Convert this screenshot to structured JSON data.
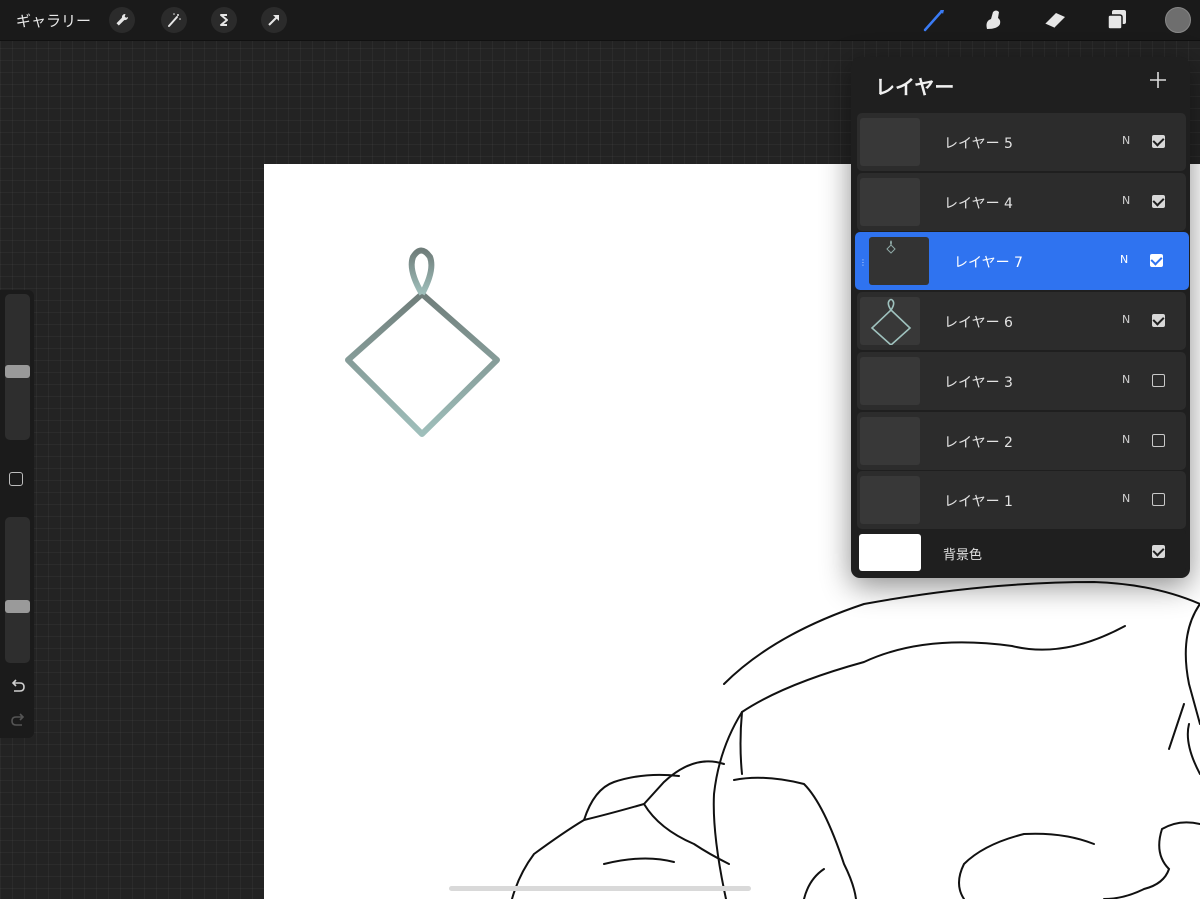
{
  "topbar": {
    "gallery_label": "ギャラリー",
    "left_tools": [
      "wrench-icon",
      "magic-wand-icon",
      "selection-icon",
      "transform-arrow-icon"
    ],
    "right_tools": [
      "brush-icon",
      "smudge-icon",
      "eraser-icon",
      "layers-icon"
    ],
    "active_tool": "brush",
    "accent_color": "#2f73f0",
    "current_color": "#6e6e6e"
  },
  "sidebar": {
    "brush_size_level": 0.45,
    "opacity_level": 0.6
  },
  "layers_panel": {
    "title": "レイヤー",
    "add_icon": "plus-icon",
    "layers": [
      {
        "name": "レイヤー 5",
        "blend": "N",
        "visible": true,
        "active": false
      },
      {
        "name": "レイヤー 4",
        "blend": "N",
        "visible": true,
        "active": false
      },
      {
        "name": "レイヤー 7",
        "blend": "N",
        "visible": true,
        "active": true
      },
      {
        "name": "レイヤー 6",
        "blend": "N",
        "visible": true,
        "active": false
      },
      {
        "name": "レイヤー 3",
        "blend": "N",
        "visible": false,
        "active": false
      },
      {
        "name": "レイヤー 2",
        "blend": "N",
        "visible": false,
        "active": false
      },
      {
        "name": "レイヤー 1",
        "blend": "N",
        "visible": false,
        "active": false
      }
    ],
    "background": {
      "name": "背景色",
      "visible": true,
      "color": "#ffffff"
    }
  },
  "canvas": {
    "ornament_color_top": "#6f7d7a",
    "ornament_color_bottom": "#9fbfbb"
  }
}
